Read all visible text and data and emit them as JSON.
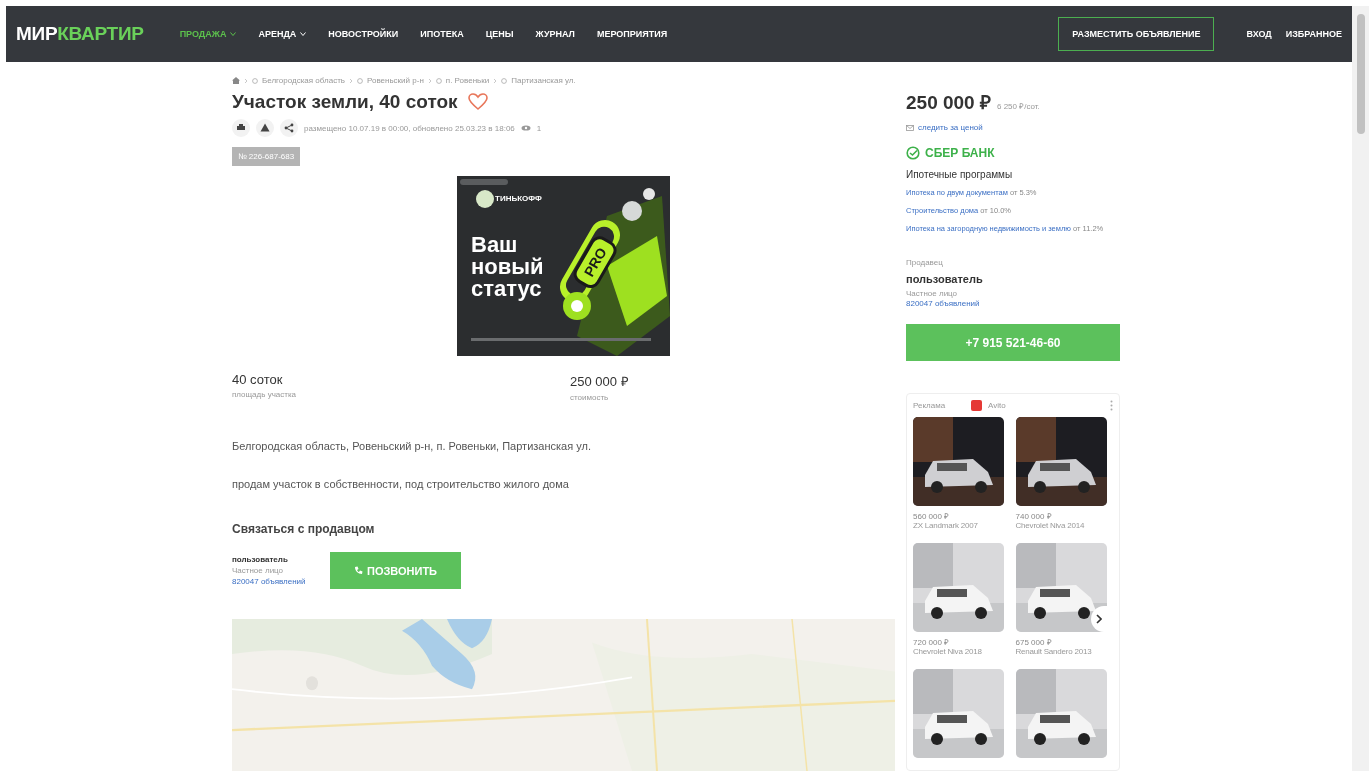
{
  "header": {
    "logo": {
      "part1": "МИР",
      "part2": "КВАРТИР"
    },
    "nav": [
      {
        "label": "ПРОДАЖА",
        "selected": true,
        "dropdown": true
      },
      {
        "label": "АРЕНДА",
        "selected": false,
        "dropdown": true
      },
      {
        "label": "НОВОСТРОЙКИ",
        "selected": false,
        "dropdown": false
      },
      {
        "label": "ИПОТЕКА",
        "selected": false,
        "dropdown": false
      },
      {
        "label": "ЦЕНЫ",
        "selected": false,
        "dropdown": false
      },
      {
        "label": "ЖУРНАЛ",
        "selected": false,
        "dropdown": false
      },
      {
        "label": "МЕРОПРИЯТИЯ",
        "selected": false,
        "dropdown": false
      }
    ],
    "post_button": "РАЗМЕСТИТЬ ОБЪЯВЛЕНИЕ",
    "links": [
      "ВХОД",
      "ИЗБРАННОЕ"
    ]
  },
  "breadcrumbs": [
    "Белгородская область",
    "Ровеньский р-н",
    "п. Ровеньки",
    "Партизанская ул."
  ],
  "title": "Участок земли, 40 соток",
  "favorite": false,
  "meta": {
    "dates": "размещено 10.07.19 в 00:00, обновлено 25.03.23 в 18:06",
    "views": "1"
  },
  "listing_id": "№ 226-687-683",
  "ad": {
    "brand": "ТИНЬКОФФ",
    "headline": "Ваш новый статус",
    "badge": "PRO"
  },
  "facts": [
    {
      "value": "40 соток",
      "label": "площадь участка"
    },
    {
      "value": "250 000 ₽",
      "label": "стоимость"
    }
  ],
  "address": "Белгородская область, Ровеньский р-н, п. Ровеньки, Партизанская ул.",
  "description": "продам участок в собственности, под строительство жилого дома",
  "contact": {
    "heading": "Связаться с продавцом",
    "name": "пользователь",
    "type": "Частное лицо",
    "listings": "820047 объявлений",
    "call_button": "ПОЗВОНИТЬ"
  },
  "map": {
    "kind": "picture"
  },
  "sidebar": {
    "price": "250 000 ₽",
    "price_per": "6 250 ₽/сот.",
    "watch": "следить за ценой",
    "bank": "СБЕР БАНК",
    "programs_title": "Ипотечные программы",
    "programs": [
      {
        "link": "Ипотека по двум документам",
        "rate": "от 5.3%"
      },
      {
        "link": "Строительство дома",
        "rate": "от 10.0%"
      },
      {
        "link": "Ипотека на загородную недвижимость и землю",
        "rate": "от 11.2%"
      }
    ],
    "seller_label": "Продавец",
    "seller": "пользователь",
    "seller_type": "Частное лицо",
    "seller_listings": "820047 объявлений",
    "phone": "+7 915 521-46-60"
  },
  "promo": {
    "label": "Реклама",
    "source": "Avito",
    "cars": [
      {
        "kind": "listing",
        "price": "560 000 ₽",
        "name": "ZX Landmark 2007"
      },
      {
        "kind": "listing",
        "price": "740 000 ₽",
        "name": "Chevrolet Niva 2014"
      },
      {
        "kind": "listing",
        "price": "720 000 ₽",
        "name": "Chevrolet Niva 2018"
      },
      {
        "kind": "listing",
        "price": "675 000 ₽",
        "name": "Renault Sandero 2013"
      },
      {
        "kind": "picture"
      },
      {
        "kind": "picture"
      }
    ]
  }
}
